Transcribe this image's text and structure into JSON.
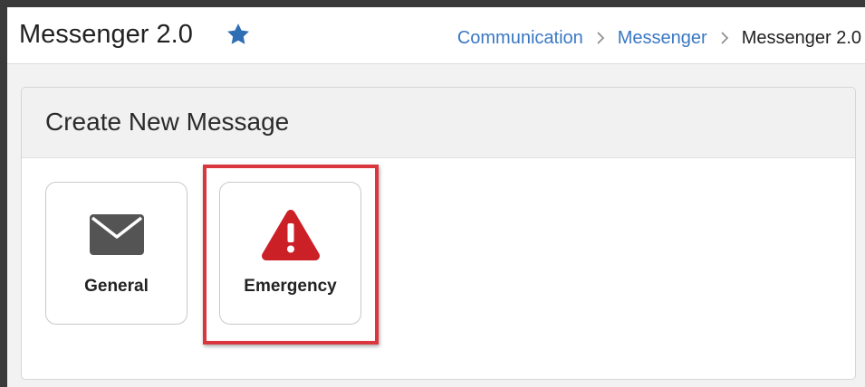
{
  "header": {
    "title": "Messenger 2.0",
    "favorite_icon": "star-icon",
    "breadcrumb": [
      {
        "label": "Communication",
        "link": true
      },
      {
        "label": "Messenger",
        "link": true
      },
      {
        "label": "Messenger 2.0",
        "link": false
      }
    ]
  },
  "panel": {
    "title": "Create New Message",
    "tiles": [
      {
        "label": "General",
        "icon": "envelope-icon"
      },
      {
        "label": "Emergency",
        "icon": "warning-triangle-icon"
      }
    ]
  },
  "colors": {
    "link": "#3a78c3",
    "star": "#2f6db5",
    "envelope": "#545454",
    "warning": "#cc2027",
    "highlight": "#d9363e"
  }
}
